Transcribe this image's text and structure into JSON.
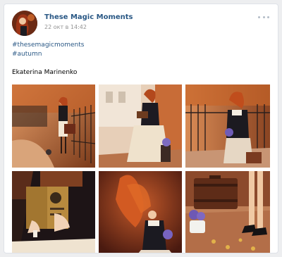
{
  "post": {
    "author": "These Magic Moments",
    "date": "22 окт в 14:42",
    "hashtags": [
      "#thesemagicmoments",
      "#autumn"
    ],
    "caption": "Ekaterina Marinenko"
  },
  "icons": {
    "menu": "more-dots-icon"
  },
  "photos": [
    {
      "subject": "girl with suitcase by fence"
    },
    {
      "subject": "girl reading on stool"
    },
    {
      "subject": "girl with flowers at fence"
    },
    {
      "subject": "hands holding book"
    },
    {
      "subject": "girl with flowing red hair"
    },
    {
      "subject": "suitcase and flower pot"
    }
  ],
  "colors": {
    "link": "#2a5885",
    "meta": "#939393",
    "background": "#edeef0"
  }
}
